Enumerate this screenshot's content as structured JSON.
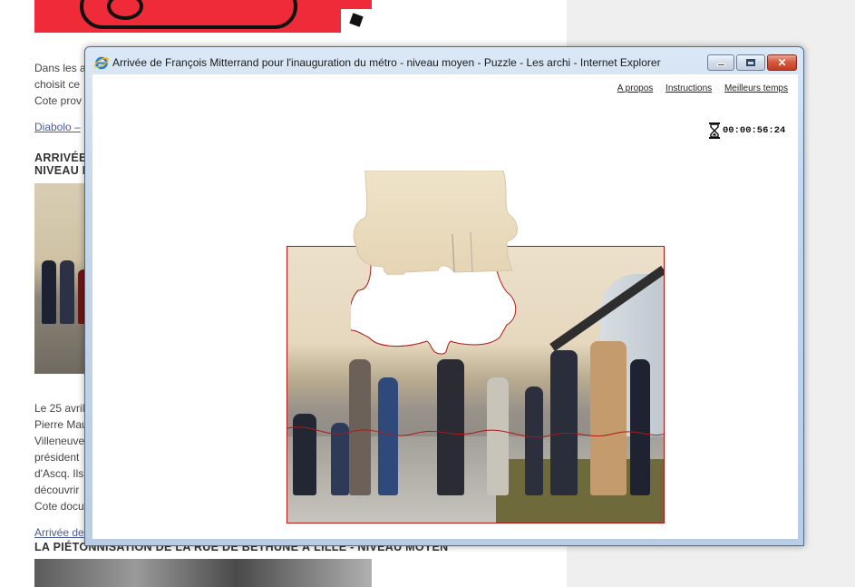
{
  "background_page": {
    "paragraph_1": [
      "Dans les a",
      "choisit ce",
      "Cote prov"
    ],
    "link_1": "Diabolo –",
    "heading_1": [
      "ARRIVÉE",
      "NIVEAU I"
    ],
    "paragraph_2": [
      "Le 25 avril",
      "Pierre Mau",
      "Villeneuve",
      "président",
      "d'Ascq. Ils",
      "découvrir",
      "Cote docu"
    ],
    "link_2": "Arrivée de",
    "heading_2": "LA PIÉTONNISATION DE LA RUE DE BÉTHUNE À LILLE - NIVEAU MOYEN"
  },
  "window": {
    "title": "Arrivée de François Mitterrand pour l'inauguration du métro - niveau moyen - Puzzle - Les archi - Internet Explorer",
    "icon": "internet-explorer-icon",
    "controls": {
      "minimize": "minimize-icon",
      "maximize": "maximize-icon",
      "close": "close-icon"
    }
  },
  "puzzle_page": {
    "links": [
      "A propos",
      "Instructions",
      "Meilleurs temps"
    ],
    "timer": "00:00:56:24",
    "timer_icon": "hourglass-icon"
  },
  "colors": {
    "piece_outline": "#b01818",
    "window_frame": "#c5d7ec",
    "close_button": "#c13c22"
  }
}
